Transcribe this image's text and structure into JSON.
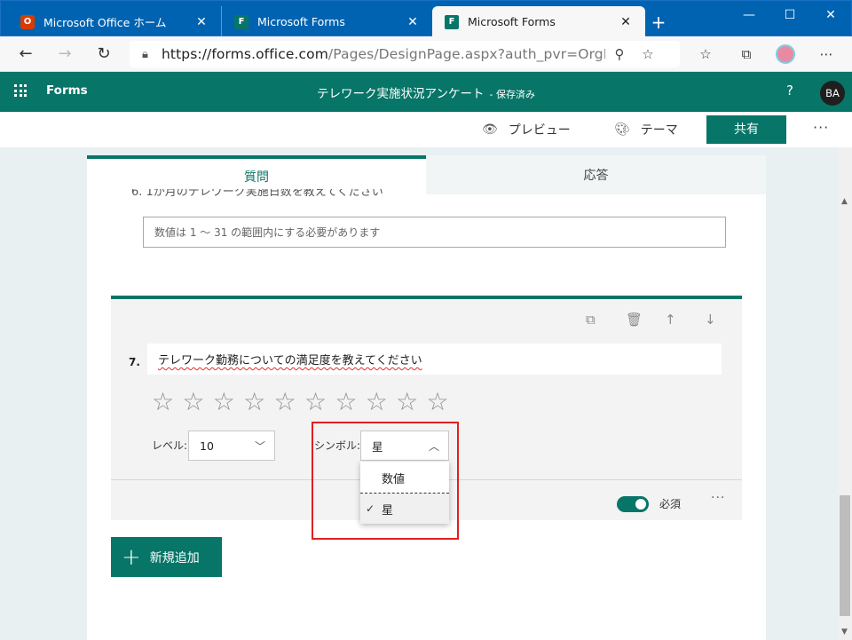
{
  "browser": {
    "tabs": [
      {
        "label": "Microsoft Office ホーム",
        "icon": "office-icon"
      },
      {
        "label": "Microsoft Forms",
        "icon": "forms-icon"
      },
      {
        "label": "Microsoft Forms",
        "icon": "forms-icon",
        "active": true
      }
    ],
    "url_main": "https://forms.office.com",
    "url_rest": "/Pages/DesignPage.aspx?auth_pvr=OrgId&a..."
  },
  "app": {
    "name": "Forms",
    "doc_title": "テレワーク実施状況アンケート",
    "save_status": "- 保存済み",
    "help": "?",
    "avatar": "BA"
  },
  "commands": {
    "preview": "プレビュー",
    "theme": "テーマ",
    "share": "共有"
  },
  "form_tabs": {
    "questions": "質問",
    "responses": "応答"
  },
  "previous_question": {
    "cut_title": "6. 1か月のテレワーク実施日数を教えてください",
    "placeholder": "数値は 1 ～ 31 の範囲内にする必要があります"
  },
  "question": {
    "number": "7.",
    "title": "テレワーク勤務についての満足度を教えてください",
    "rating_count": 10,
    "level_label": "レベル:",
    "level_value": "10",
    "symbol_label": "シンボル:",
    "symbol_value": "星",
    "required_label": "必須",
    "required": true
  },
  "symbol_dropdown": {
    "options": [
      "数値",
      "星"
    ],
    "selected": "星"
  },
  "add_new": "新規追加",
  "colors": {
    "brand": "#077568",
    "titlebar": "#0063b1",
    "highlight": "#e02020"
  }
}
